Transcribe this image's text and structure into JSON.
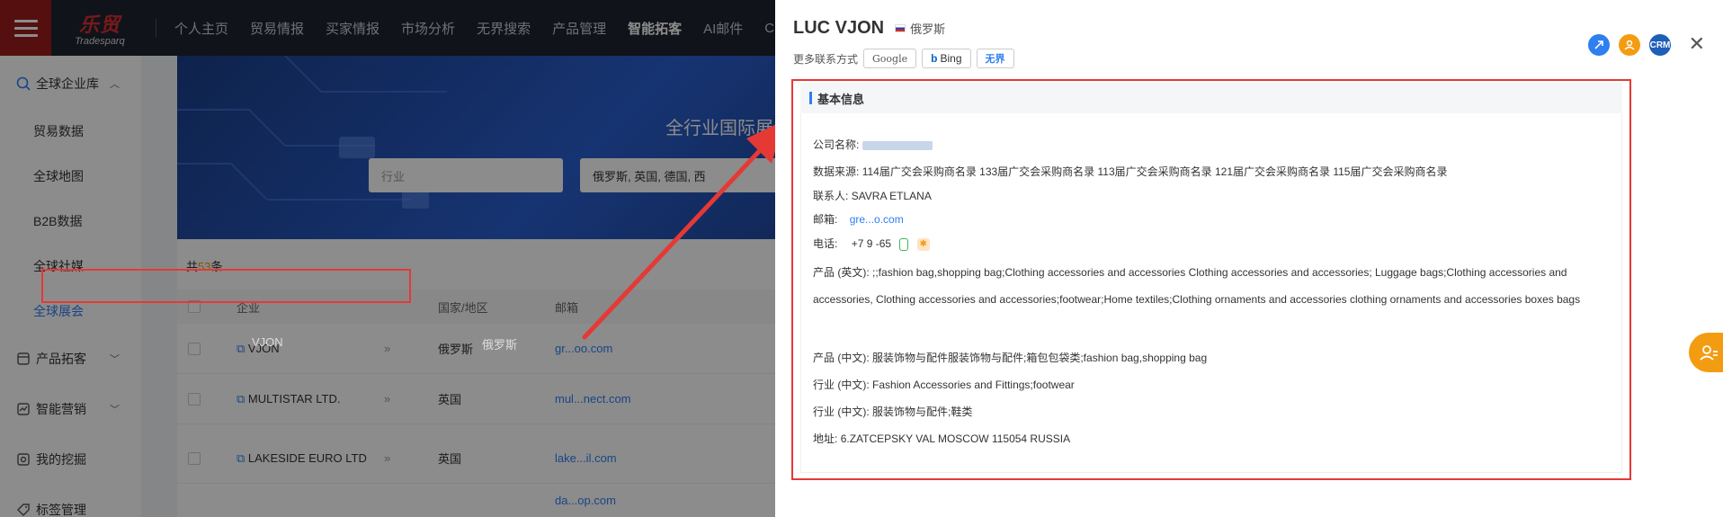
{
  "nav": {
    "logo_mark": "乐贸",
    "logo_sub": "Tradesparq",
    "items": [
      {
        "label": "个人主页",
        "active": false
      },
      {
        "label": "贸易情报",
        "active": false
      },
      {
        "label": "买家情报",
        "active": false
      },
      {
        "label": "市场分析",
        "active": false
      },
      {
        "label": "无界搜索",
        "active": false
      },
      {
        "label": "产品管理",
        "active": false
      },
      {
        "label": "智能拓客",
        "active": true
      },
      {
        "label": "AI邮件",
        "active": false
      },
      {
        "label": "CRM",
        "active": false
      }
    ]
  },
  "sidebar": {
    "groups": [
      {
        "label": "全球企业库",
        "icon": "globe-search-icon",
        "expanded": true,
        "items": [
          {
            "label": "贸易数据",
            "active": false
          },
          {
            "label": "全球地图",
            "active": false
          },
          {
            "label": "B2B数据",
            "active": false
          },
          {
            "label": "全球社媒",
            "active": false
          },
          {
            "label": "全球展会",
            "active": true
          }
        ]
      },
      {
        "label": "产品拓客",
        "icon": "box-icon"
      },
      {
        "label": "智能营销",
        "icon": "marketing-icon"
      },
      {
        "label": "我的挖掘",
        "icon": "dig-icon"
      },
      {
        "label": "标签管理",
        "icon": "tag-icon"
      }
    ]
  },
  "banner": {
    "title": "全行业国际展会的海",
    "industry_placeholder": "行业",
    "country_value": "俄罗斯, 英国, 德国, 西"
  },
  "list": {
    "total_prefix": "共",
    "total_count": "53",
    "total_suffix": "条",
    "headers": {
      "company": "企业",
      "country": "国家/地区",
      "email": "邮箱"
    },
    "rows": [
      {
        "company": "VJON",
        "country": "俄罗斯",
        "email": "gr...oo.com"
      },
      {
        "company": "MULTISTAR LTD.",
        "country": "英国",
        "email": "mul...nect.com"
      },
      {
        "company": "LAKESIDE EURO LTD",
        "country": "英国",
        "email": "lake...il.com"
      },
      {
        "company": "",
        "country": "",
        "email": "da...op.com"
      }
    ]
  },
  "drawer": {
    "title": "LUC VJON",
    "country": "俄罗斯",
    "more_contacts_label": "更多联系方式",
    "chips": {
      "google": "Google",
      "bing": "Bing",
      "wujie": "无界"
    },
    "crm_label": "CRM",
    "section_title": "基本信息",
    "fields": {
      "company_label": "公司名称:",
      "source_label": "数据来源:",
      "source_value": "114届广交会采购商名录 133届广交会采购商名录 113届广交会采购商名录 121届广交会采购商名录 115届广交会采购商名录",
      "contact_label": "联系人:",
      "contact_value": "SAVRA ETLANA",
      "email_label": "邮箱:",
      "email_value": "gre...o.com",
      "phone_label": "电话:",
      "phone_value": "+7 9 -65",
      "product_en_label": "产品 (英文):",
      "product_en_value": ";;fashion bag,shopping bag;Clothing accessories and accessories Clothing accessories and accessories; Luggage bags;Clothing accessories and accessories, Clothing accessories and accessories;footwear;Home textiles;Clothing ornaments and accessories clothing ornaments and accessories boxes bags",
      "product_cn_label": "产品 (中文):",
      "product_cn_value": "服装饰物与配件服装饰物与配件;箱包包袋类;fashion bag,shopping bag",
      "industry_cn1_label": "行业 (中文):",
      "industry_cn1_value": "Fashion Accessories and Fittings;footwear",
      "industry_cn2_label": "行业 (中文):",
      "industry_cn2_value": "服装饰物与配件;鞋类",
      "address_label": "地址:",
      "address_value": "6.ZATCEPSKY VAL MOSCOW 115054 RUSSIA"
    }
  },
  "colors": {
    "nav_bg": "#1f2330",
    "brand_red": "#9b1c1c",
    "accent_blue": "#2e7ff0",
    "highlight_red": "#e53935",
    "orange": "#f39c12"
  }
}
